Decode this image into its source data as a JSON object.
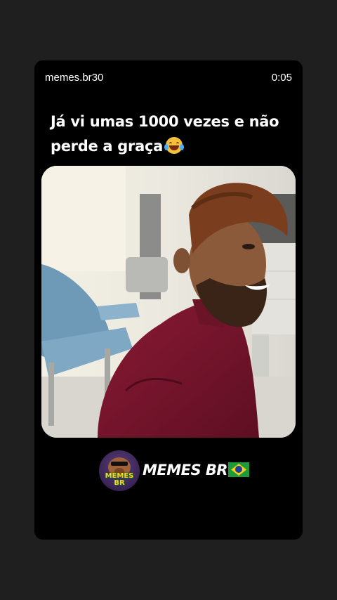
{
  "header": {
    "username": "memes.br30",
    "time": "0:05"
  },
  "post": {
    "caption_line1": "Já vi umas 1000 vezes e não",
    "caption_line2": "perde a graça",
    "caption_emoji": "face-with-tears-of-joy-icon"
  },
  "brand": {
    "logo_text": "MEMES BR",
    "name": "MEMES BR",
    "flag": "brazil-flag-icon"
  },
  "colors": {
    "background": "#1f1f1f",
    "card": "#000000",
    "text": "#ffffff"
  }
}
